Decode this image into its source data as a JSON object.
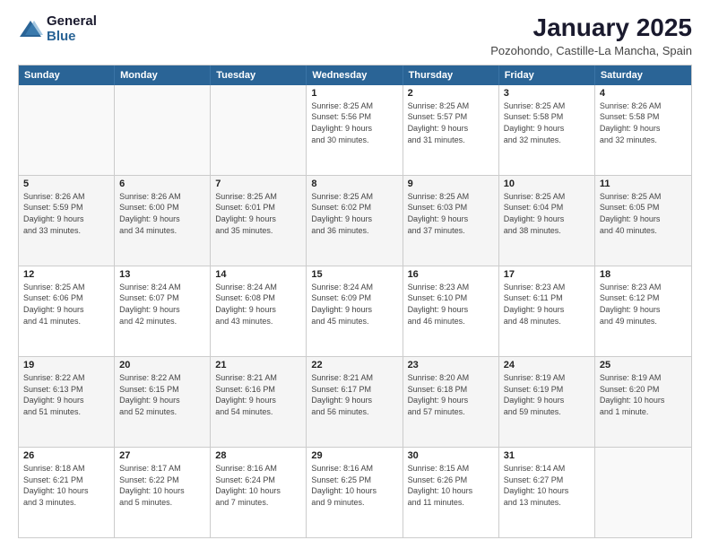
{
  "logo": {
    "general": "General",
    "blue": "Blue"
  },
  "header": {
    "month": "January 2025",
    "location": "Pozohondo, Castille-La Mancha, Spain"
  },
  "days": [
    "Sunday",
    "Monday",
    "Tuesday",
    "Wednesday",
    "Thursday",
    "Friday",
    "Saturday"
  ],
  "weeks": [
    [
      {
        "day": "",
        "info": ""
      },
      {
        "day": "",
        "info": ""
      },
      {
        "day": "",
        "info": ""
      },
      {
        "day": "1",
        "info": "Sunrise: 8:25 AM\nSunset: 5:56 PM\nDaylight: 9 hours\nand 30 minutes."
      },
      {
        "day": "2",
        "info": "Sunrise: 8:25 AM\nSunset: 5:57 PM\nDaylight: 9 hours\nand 31 minutes."
      },
      {
        "day": "3",
        "info": "Sunrise: 8:25 AM\nSunset: 5:58 PM\nDaylight: 9 hours\nand 32 minutes."
      },
      {
        "day": "4",
        "info": "Sunrise: 8:26 AM\nSunset: 5:58 PM\nDaylight: 9 hours\nand 32 minutes."
      }
    ],
    [
      {
        "day": "5",
        "info": "Sunrise: 8:26 AM\nSunset: 5:59 PM\nDaylight: 9 hours\nand 33 minutes."
      },
      {
        "day": "6",
        "info": "Sunrise: 8:26 AM\nSunset: 6:00 PM\nDaylight: 9 hours\nand 34 minutes."
      },
      {
        "day": "7",
        "info": "Sunrise: 8:25 AM\nSunset: 6:01 PM\nDaylight: 9 hours\nand 35 minutes."
      },
      {
        "day": "8",
        "info": "Sunrise: 8:25 AM\nSunset: 6:02 PM\nDaylight: 9 hours\nand 36 minutes."
      },
      {
        "day": "9",
        "info": "Sunrise: 8:25 AM\nSunset: 6:03 PM\nDaylight: 9 hours\nand 37 minutes."
      },
      {
        "day": "10",
        "info": "Sunrise: 8:25 AM\nSunset: 6:04 PM\nDaylight: 9 hours\nand 38 minutes."
      },
      {
        "day": "11",
        "info": "Sunrise: 8:25 AM\nSunset: 6:05 PM\nDaylight: 9 hours\nand 40 minutes."
      }
    ],
    [
      {
        "day": "12",
        "info": "Sunrise: 8:25 AM\nSunset: 6:06 PM\nDaylight: 9 hours\nand 41 minutes."
      },
      {
        "day": "13",
        "info": "Sunrise: 8:24 AM\nSunset: 6:07 PM\nDaylight: 9 hours\nand 42 minutes."
      },
      {
        "day": "14",
        "info": "Sunrise: 8:24 AM\nSunset: 6:08 PM\nDaylight: 9 hours\nand 43 minutes."
      },
      {
        "day": "15",
        "info": "Sunrise: 8:24 AM\nSunset: 6:09 PM\nDaylight: 9 hours\nand 45 minutes."
      },
      {
        "day": "16",
        "info": "Sunrise: 8:23 AM\nSunset: 6:10 PM\nDaylight: 9 hours\nand 46 minutes."
      },
      {
        "day": "17",
        "info": "Sunrise: 8:23 AM\nSunset: 6:11 PM\nDaylight: 9 hours\nand 48 minutes."
      },
      {
        "day": "18",
        "info": "Sunrise: 8:23 AM\nSunset: 6:12 PM\nDaylight: 9 hours\nand 49 minutes."
      }
    ],
    [
      {
        "day": "19",
        "info": "Sunrise: 8:22 AM\nSunset: 6:13 PM\nDaylight: 9 hours\nand 51 minutes."
      },
      {
        "day": "20",
        "info": "Sunrise: 8:22 AM\nSunset: 6:15 PM\nDaylight: 9 hours\nand 52 minutes."
      },
      {
        "day": "21",
        "info": "Sunrise: 8:21 AM\nSunset: 6:16 PM\nDaylight: 9 hours\nand 54 minutes."
      },
      {
        "day": "22",
        "info": "Sunrise: 8:21 AM\nSunset: 6:17 PM\nDaylight: 9 hours\nand 56 minutes."
      },
      {
        "day": "23",
        "info": "Sunrise: 8:20 AM\nSunset: 6:18 PM\nDaylight: 9 hours\nand 57 minutes."
      },
      {
        "day": "24",
        "info": "Sunrise: 8:19 AM\nSunset: 6:19 PM\nDaylight: 9 hours\nand 59 minutes."
      },
      {
        "day": "25",
        "info": "Sunrise: 8:19 AM\nSunset: 6:20 PM\nDaylight: 10 hours\nand 1 minute."
      }
    ],
    [
      {
        "day": "26",
        "info": "Sunrise: 8:18 AM\nSunset: 6:21 PM\nDaylight: 10 hours\nand 3 minutes."
      },
      {
        "day": "27",
        "info": "Sunrise: 8:17 AM\nSunset: 6:22 PM\nDaylight: 10 hours\nand 5 minutes."
      },
      {
        "day": "28",
        "info": "Sunrise: 8:16 AM\nSunset: 6:24 PM\nDaylight: 10 hours\nand 7 minutes."
      },
      {
        "day": "29",
        "info": "Sunrise: 8:16 AM\nSunset: 6:25 PM\nDaylight: 10 hours\nand 9 minutes."
      },
      {
        "day": "30",
        "info": "Sunrise: 8:15 AM\nSunset: 6:26 PM\nDaylight: 10 hours\nand 11 minutes."
      },
      {
        "day": "31",
        "info": "Sunrise: 8:14 AM\nSunset: 6:27 PM\nDaylight: 10 hours\nand 13 minutes."
      },
      {
        "day": "",
        "info": ""
      }
    ]
  ]
}
